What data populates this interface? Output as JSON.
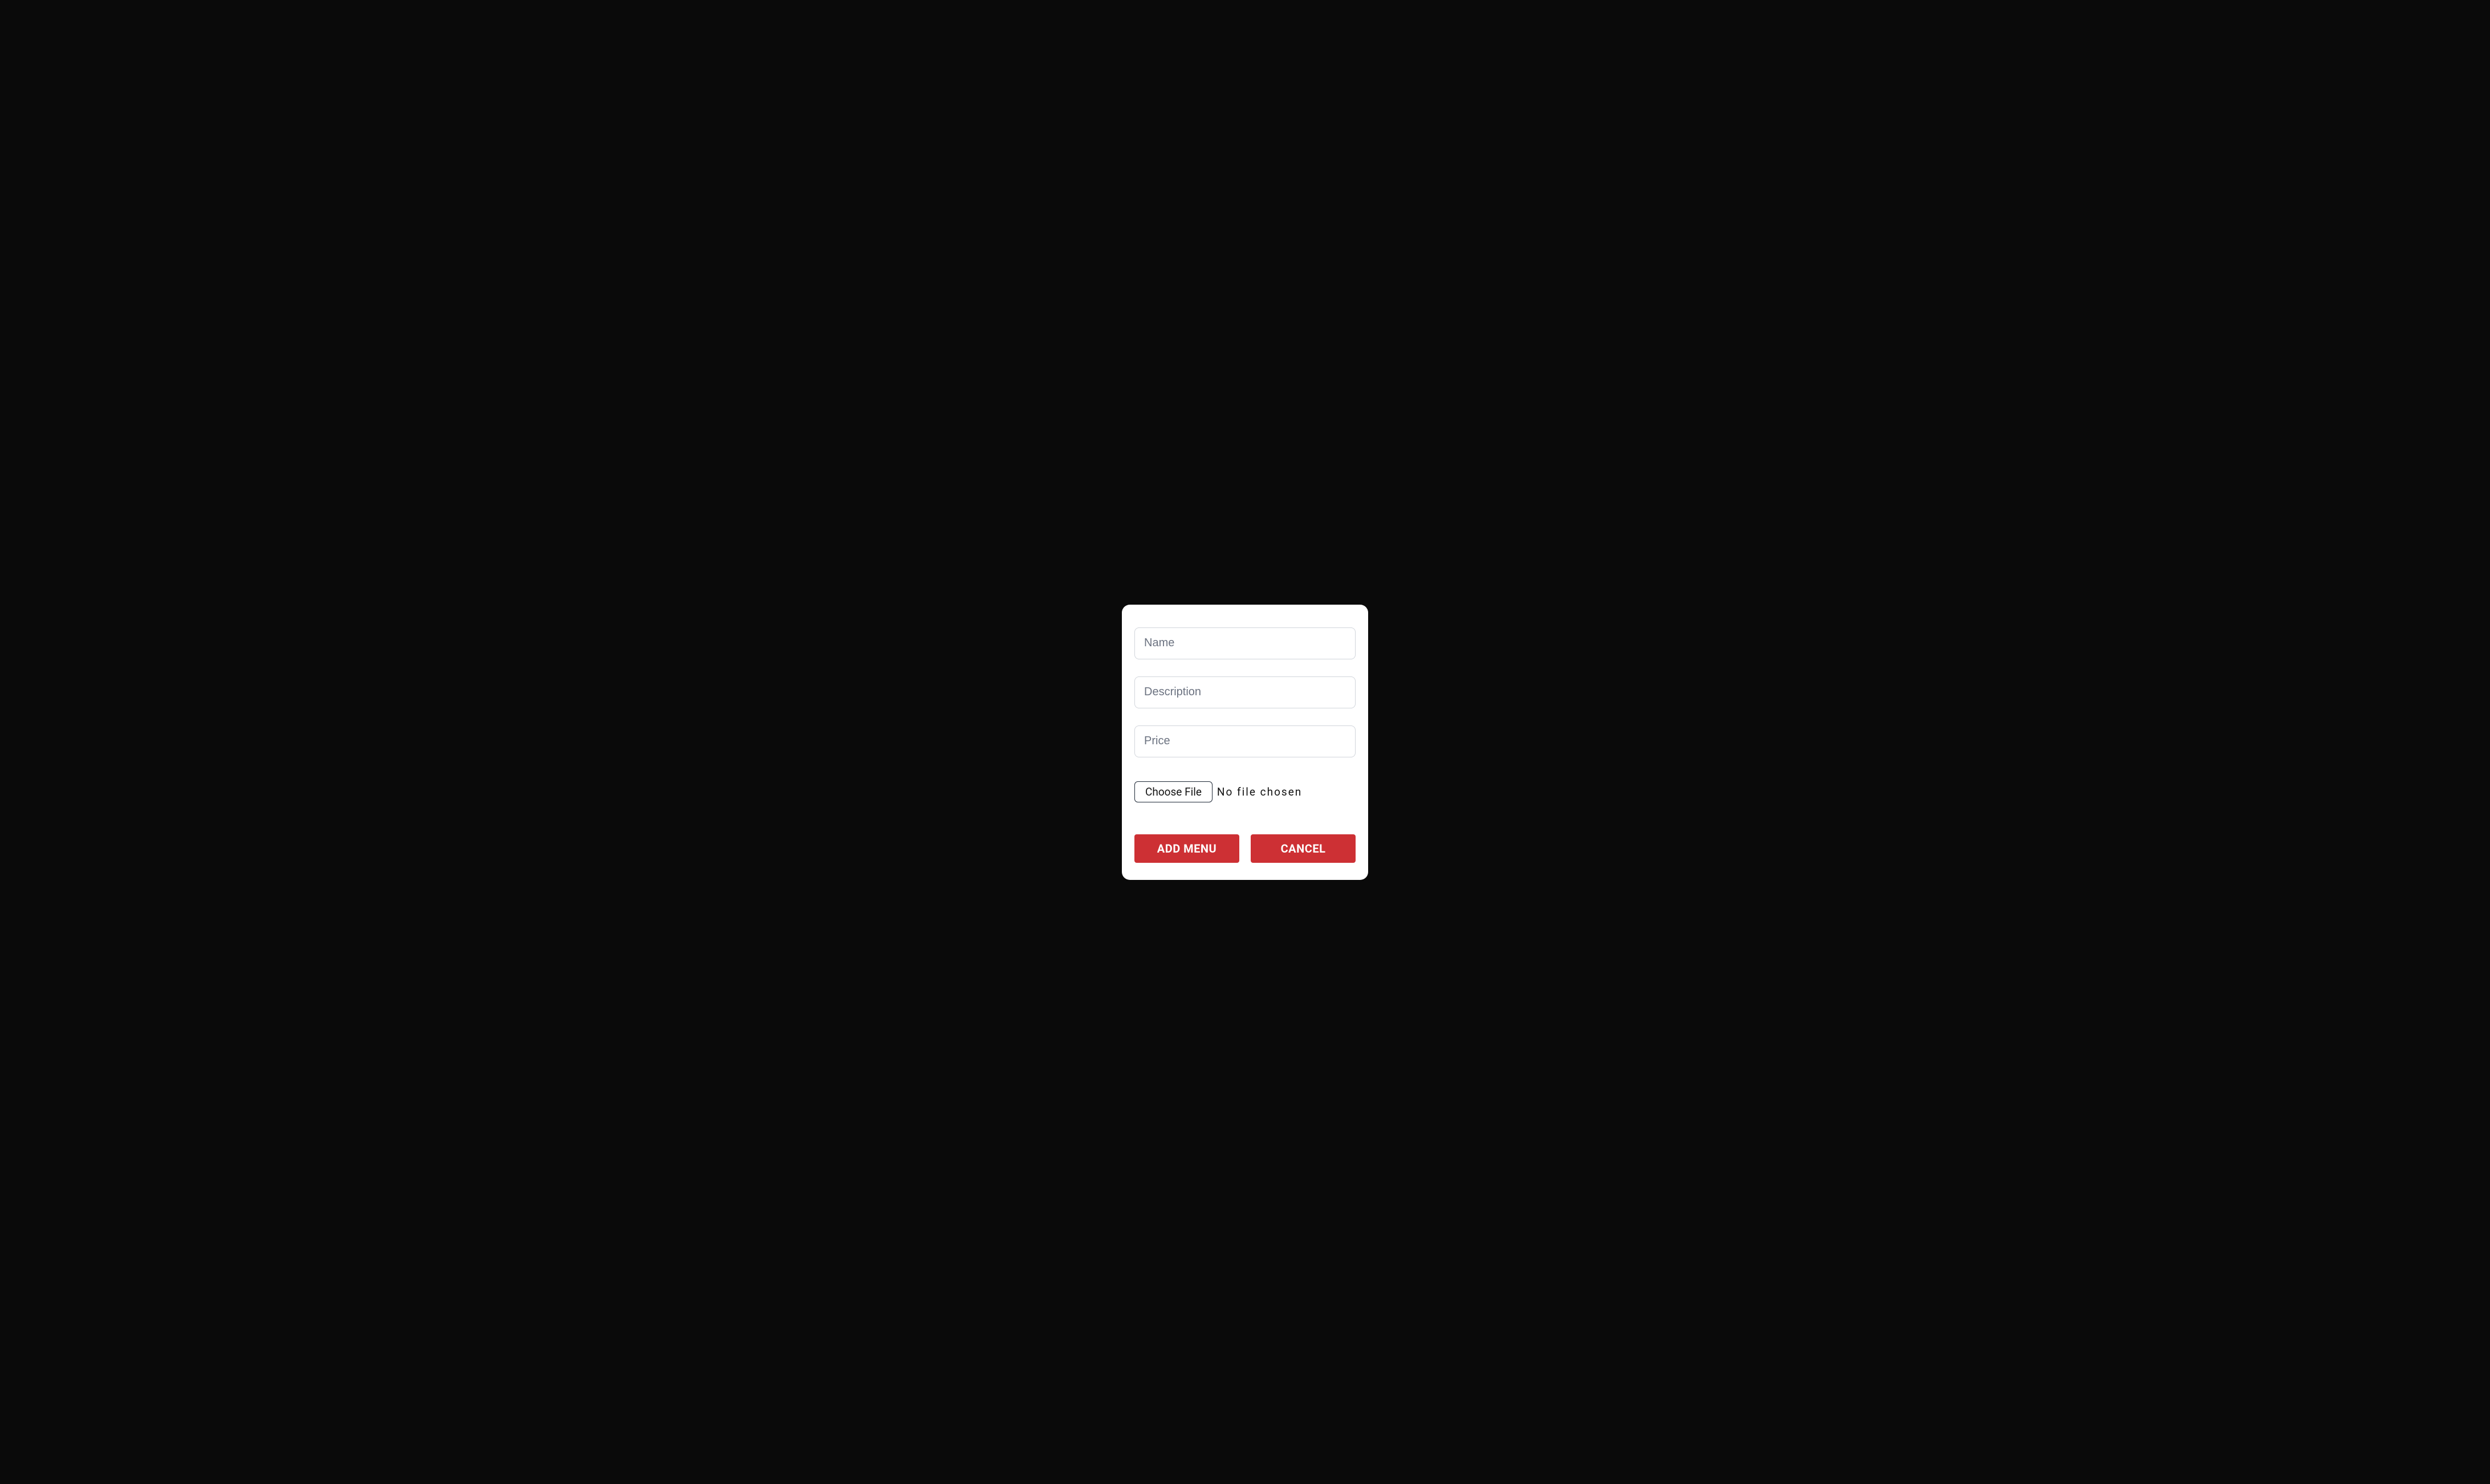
{
  "form": {
    "name_placeholder": "Name",
    "description_placeholder": "Description",
    "price_placeholder": "Price",
    "file_button_label": "Choose File",
    "file_status_text": "No file chosen"
  },
  "buttons": {
    "submit_label": "ADD MENU",
    "cancel_label": "CANCEL"
  },
  "colors": {
    "accent": "#cd3034",
    "background": "#0a0a0a",
    "modal_background": "#ffffff",
    "input_border": "#d1d5db",
    "placeholder": "#6b7280"
  }
}
